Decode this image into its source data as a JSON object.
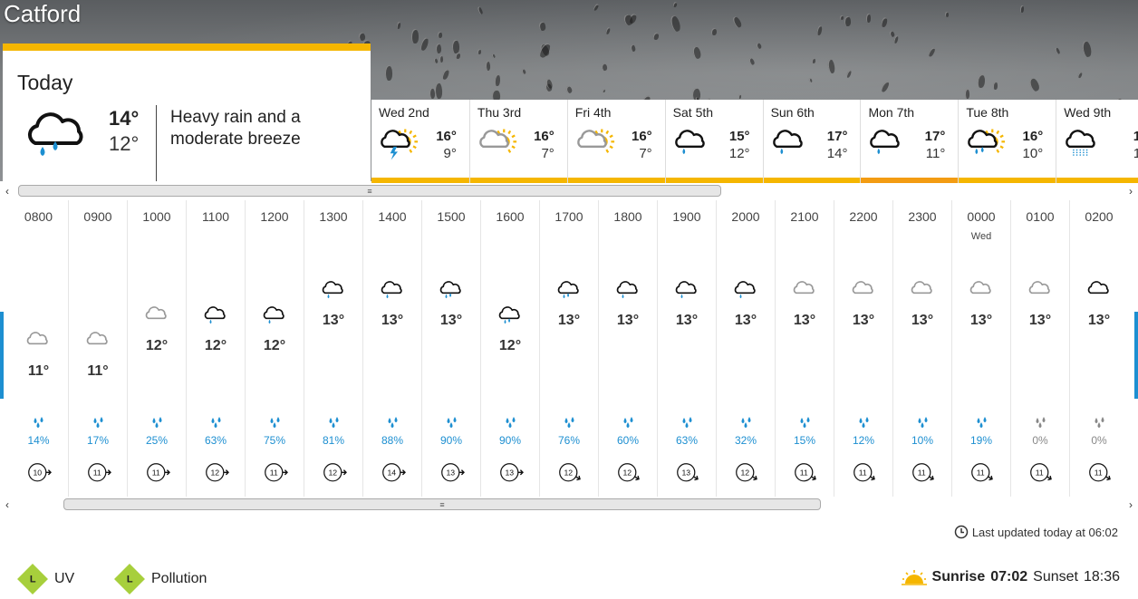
{
  "location": "Catford",
  "today": {
    "title": "Today",
    "high": "14°",
    "low": "12°",
    "description": "Heavy rain and a moderate breeze",
    "icon": "heavy-rain-cloud-icon"
  },
  "days": [
    {
      "name": "Wed 2nd",
      "high": "16°",
      "low": "9°",
      "icon": "thunder-sun-cloud-icon",
      "bar": "#f5b600"
    },
    {
      "name": "Thu 3rd",
      "high": "16°",
      "low": "7°",
      "icon": "sun-cloud-icon",
      "bar": "#f5b600"
    },
    {
      "name": "Fri 4th",
      "high": "16°",
      "low": "7°",
      "icon": "sun-cloud-icon",
      "bar": "#f5b600"
    },
    {
      "name": "Sat 5th",
      "high": "15°",
      "low": "12°",
      "icon": "light-rain-cloud-icon",
      "bar": "#f5b600"
    },
    {
      "name": "Sun 6th",
      "high": "17°",
      "low": "14°",
      "icon": "light-rain-cloud-icon",
      "bar": "#f5b600"
    },
    {
      "name": "Mon 7th",
      "high": "17°",
      "low": "11°",
      "icon": "light-rain-cloud-icon",
      "bar": "#f39c12"
    },
    {
      "name": "Tue 8th",
      "high": "16°",
      "low": "10°",
      "icon": "sun-rain-cloud-icon",
      "bar": "#f5b600"
    },
    {
      "name": "Wed 9th",
      "high": "1",
      "low": "1",
      "icon": "drizzle-cloud-icon",
      "bar": "#f5b600"
    }
  ],
  "hours": [
    {
      "time": "0800",
      "day": "",
      "temp": "11°",
      "icon": "grey-cloud-icon",
      "rain": "14%",
      "wind": "10",
      "rain_color": "#1d8fd1"
    },
    {
      "time": "0900",
      "day": "",
      "temp": "11°",
      "icon": "grey-cloud-icon",
      "rain": "17%",
      "wind": "11",
      "rain_color": "#1d8fd1"
    },
    {
      "time": "1000",
      "day": "",
      "temp": "12°",
      "icon": "grey-cloud-icon",
      "rain": "25%",
      "wind": "11",
      "rain_color": "#1d8fd1"
    },
    {
      "time": "1100",
      "day": "",
      "temp": "12°",
      "icon": "light-rain-cloud-icon",
      "rain": "63%",
      "wind": "12",
      "rain_color": "#1d8fd1"
    },
    {
      "time": "1200",
      "day": "",
      "temp": "12°",
      "icon": "light-rain-cloud-icon",
      "rain": "75%",
      "wind": "11",
      "rain_color": "#1d8fd1"
    },
    {
      "time": "1300",
      "day": "",
      "temp": "13°",
      "icon": "light-rain-cloud-icon",
      "rain": "81%",
      "wind": "12",
      "rain_color": "#1d8fd1"
    },
    {
      "time": "1400",
      "day": "",
      "temp": "13°",
      "icon": "light-rain-cloud-icon",
      "rain": "88%",
      "wind": "14",
      "rain_color": "#1d8fd1"
    },
    {
      "time": "1500",
      "day": "",
      "temp": "13°",
      "icon": "heavy-rain-cloud-icon",
      "rain": "90%",
      "wind": "13",
      "rain_color": "#1d8fd1"
    },
    {
      "time": "1600",
      "day": "",
      "temp": "12°",
      "icon": "heavy-rain-cloud-icon",
      "rain": "90%",
      "wind": "13",
      "rain_color": "#1d8fd1"
    },
    {
      "time": "1700",
      "day": "",
      "temp": "13°",
      "icon": "heavy-rain-cloud-icon",
      "rain": "76%",
      "wind": "12",
      "rain_color": "#1d8fd1"
    },
    {
      "time": "1800",
      "day": "",
      "temp": "13°",
      "icon": "light-rain-cloud-icon",
      "rain": "60%",
      "wind": "12",
      "rain_color": "#1d8fd1"
    },
    {
      "time": "1900",
      "day": "",
      "temp": "13°",
      "icon": "moon-rain-cloud-icon",
      "rain": "63%",
      "wind": "13",
      "rain_color": "#1d8fd1"
    },
    {
      "time": "2000",
      "day": "",
      "temp": "13°",
      "icon": "moon-rain-cloud-icon",
      "rain": "32%",
      "wind": "12",
      "rain_color": "#1d8fd1"
    },
    {
      "time": "2100",
      "day": "",
      "temp": "13°",
      "icon": "grey-cloud-icon",
      "rain": "15%",
      "wind": "11",
      "rain_color": "#1d8fd1"
    },
    {
      "time": "2200",
      "day": "",
      "temp": "13°",
      "icon": "grey-cloud-icon",
      "rain": "12%",
      "wind": "11",
      "rain_color": "#1d8fd1"
    },
    {
      "time": "2300",
      "day": "",
      "temp": "13°",
      "icon": "grey-cloud-icon",
      "rain": "10%",
      "wind": "11",
      "rain_color": "#1d8fd1"
    },
    {
      "time": "0000",
      "day": "Wed",
      "temp": "13°",
      "icon": "grey-cloud-icon",
      "rain": "19%",
      "wind": "11",
      "rain_color": "#1d8fd1"
    },
    {
      "time": "0100",
      "day": "",
      "temp": "13°",
      "icon": "grey-cloud-icon",
      "rain": "0%",
      "wind": "11",
      "rain_color": "#888888"
    },
    {
      "time": "0200",
      "day": "",
      "temp": "13°",
      "icon": "black-cloud-icon",
      "rain": "0%",
      "wind": "11",
      "rain_color": "#888888"
    }
  ],
  "footer": {
    "last_updated": "Last updated today at 06:02",
    "uv_level": "L",
    "uv_label": "UV",
    "pollution_level": "L",
    "pollution_label": "Pollution",
    "sunrise_label": "Sunrise",
    "sunrise": "07:02",
    "sunset_label": "Sunset",
    "sunset": "18:36"
  },
  "colors": {
    "accent_yellow": "#f5b600",
    "rain_blue": "#1d8fd1",
    "badge_green": "#a7cf3c"
  }
}
